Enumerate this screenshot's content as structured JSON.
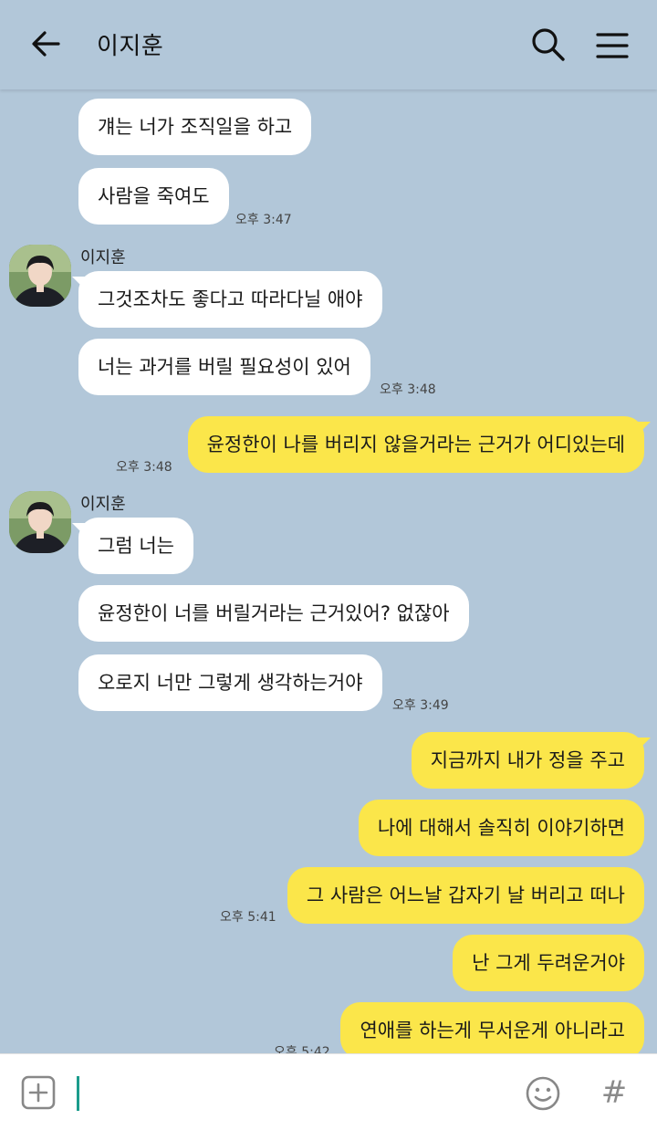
{
  "header": {
    "title": "이지훈",
    "back_icon": "arrow-left-icon",
    "search_icon": "search-icon",
    "menu_icon": "hamburger-menu-icon"
  },
  "colors": {
    "background": "#b2c7d9",
    "incoming_bubble": "#ffffff",
    "outgoing_bubble": "#fbe64a",
    "cursor": "#1b9c8c"
  },
  "messages": [
    {
      "dir": "in",
      "text": "걔는 너가 조직일을 하고"
    },
    {
      "dir": "in",
      "text": "사람을 죽여도",
      "time": "오후 3:47"
    },
    {
      "dir": "in",
      "sender": "이지훈",
      "text": "그것조차도 좋다고 따라다닐 애야"
    },
    {
      "dir": "in",
      "text": "너는 과거를 버릴 필요성이 있어",
      "time": "오후 3:48"
    },
    {
      "dir": "out",
      "text": "윤정한이 나를 버리지 않을거라는 근거가 어디있는데",
      "time": "오후 3:48"
    },
    {
      "dir": "in",
      "sender": "이지훈",
      "text": "그럼 너는"
    },
    {
      "dir": "in",
      "text": "윤정한이 너를 버릴거라는 근거있어? 없잖아"
    },
    {
      "dir": "in",
      "text": "오로지 너만 그렇게 생각하는거야",
      "time": "오후 3:49"
    },
    {
      "dir": "out",
      "text": "지금까지 내가 정을 주고"
    },
    {
      "dir": "out",
      "text": "나에 대해서 솔직히 이야기하면"
    },
    {
      "dir": "out",
      "text": "그 사람은 어느날 갑자기 날 버리고 떠나",
      "time": "오후 5:41"
    },
    {
      "dir": "out",
      "text": "난 그게 두려운거야"
    },
    {
      "dir": "out",
      "text": "연애를 하는게 무서운게 아니라고",
      "time": "오후 5:42"
    }
  ],
  "input": {
    "value": "",
    "plus_icon": "plus-box-icon",
    "emoji_icon": "smiley-icon",
    "hash_label": "#"
  }
}
